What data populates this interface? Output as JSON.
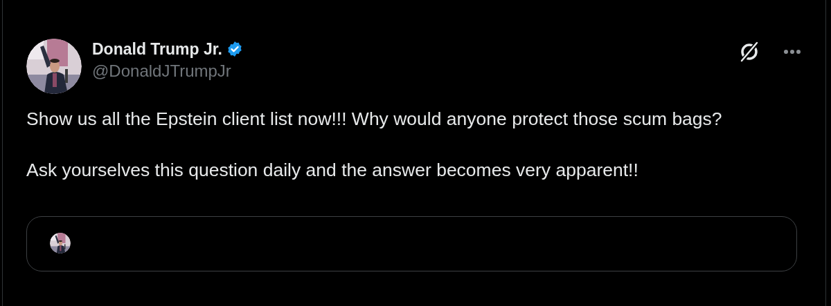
{
  "post": {
    "author": {
      "name": "Donald Trump Jr.",
      "verified": true,
      "handle": "@DonaldJTrumpJr"
    },
    "paragraphs": [
      "Show us all the Epstein client list now!!! Why would anyone protect those scum bags?",
      "Ask yourselves this question daily and the answer becomes very apparent!!"
    ]
  }
}
